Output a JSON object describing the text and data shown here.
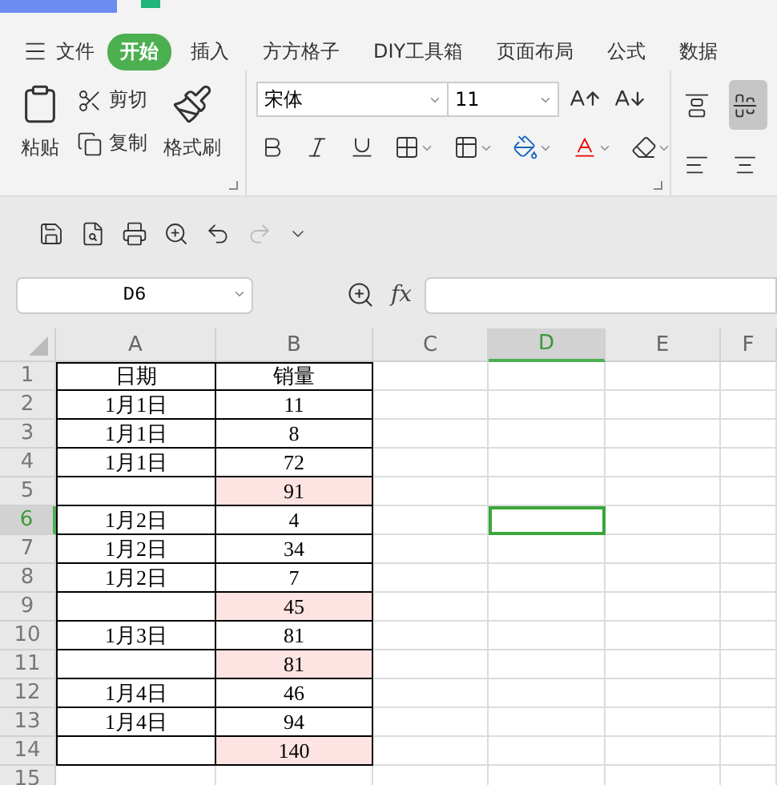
{
  "menu": {
    "label": "文件"
  },
  "tabs": [
    {
      "label": "开始",
      "selected": true
    },
    {
      "label": "插入",
      "selected": false
    },
    {
      "label": "方方格子",
      "selected": false
    },
    {
      "label": "DIY工具箱",
      "selected": false
    },
    {
      "label": "页面布局",
      "selected": false
    },
    {
      "label": "公式",
      "selected": false
    },
    {
      "label": "数据",
      "selected": false
    }
  ],
  "clipboard": {
    "paste": "粘贴",
    "cut": "剪切",
    "copy": "复制",
    "format_painter": "格式刷"
  },
  "font": {
    "name": "宋体",
    "size": "11"
  },
  "alignment": [
    {
      "kind": "top",
      "selected": false
    },
    {
      "kind": "middle",
      "selected": true
    },
    {
      "kind": "left",
      "selected": false
    },
    {
      "kind": "center",
      "selected": false
    }
  ],
  "formula_bar": {
    "name_box": "D6",
    "fx": "fx"
  },
  "columns": [
    {
      "label": "A",
      "selected": false
    },
    {
      "label": "B",
      "selected": false
    },
    {
      "label": "C",
      "selected": false
    },
    {
      "label": "D",
      "selected": true
    },
    {
      "label": "E",
      "selected": false
    },
    {
      "label": "F",
      "selected": false
    }
  ],
  "rows": [
    {
      "number": "1",
      "selected": false,
      "cells": [
        {
          "text": "日期",
          "highlighted": false
        },
        {
          "text": "销量",
          "highlighted": false
        }
      ]
    },
    {
      "number": "2",
      "selected": false,
      "cells": [
        {
          "text": "1月1日",
          "highlighted": false
        },
        {
          "text": "11",
          "highlighted": false
        }
      ]
    },
    {
      "number": "3",
      "selected": false,
      "cells": [
        {
          "text": "1月1日",
          "highlighted": false
        },
        {
          "text": "8",
          "highlighted": false
        }
      ]
    },
    {
      "number": "4",
      "selected": false,
      "cells": [
        {
          "text": "1月1日",
          "highlighted": false
        },
        {
          "text": "72",
          "highlighted": false
        }
      ]
    },
    {
      "number": "5",
      "selected": false,
      "cells": [
        {
          "highlighted": false
        },
        {
          "text": "91",
          "highlighted": true
        }
      ]
    },
    {
      "number": "6",
      "selected": true,
      "cells": [
        {
          "text": "1月2日",
          "highlighted": false
        },
        {
          "text": "4",
          "highlighted": false
        }
      ]
    },
    {
      "number": "7",
      "selected": false,
      "cells": [
        {
          "text": "1月2日",
          "highlighted": false
        },
        {
          "text": "34",
          "highlighted": false
        }
      ]
    },
    {
      "number": "8",
      "selected": false,
      "cells": [
        {
          "text": "1月2日",
          "highlighted": false
        },
        {
          "text": "7",
          "highlighted": false
        }
      ]
    },
    {
      "number": "9",
      "selected": false,
      "cells": [
        {
          "highlighted": false
        },
        {
          "text": "45",
          "highlighted": true
        }
      ]
    },
    {
      "number": "10",
      "selected": false,
      "cells": [
        {
          "text": "1月3日",
          "highlighted": false
        },
        {
          "text": "81",
          "highlighted": false
        }
      ]
    },
    {
      "number": "11",
      "selected": false,
      "cells": [
        {
          "highlighted": false
        },
        {
          "text": "81",
          "highlighted": true
        }
      ]
    },
    {
      "number": "12",
      "selected": false,
      "cells": [
        {
          "text": "1月4日",
          "highlighted": false
        },
        {
          "text": "46",
          "highlighted": false
        }
      ]
    },
    {
      "number": "13",
      "selected": false,
      "cells": [
        {
          "text": "1月4日",
          "highlighted": false
        },
        {
          "text": "94",
          "highlighted": false
        }
      ]
    },
    {
      "number": "14",
      "selected": false,
      "cells": [
        {
          "highlighted": false
        },
        {
          "text": "140",
          "highlighted": true
        }
      ]
    },
    {
      "number": "15",
      "selected": false,
      "cells": []
    }
  ]
}
